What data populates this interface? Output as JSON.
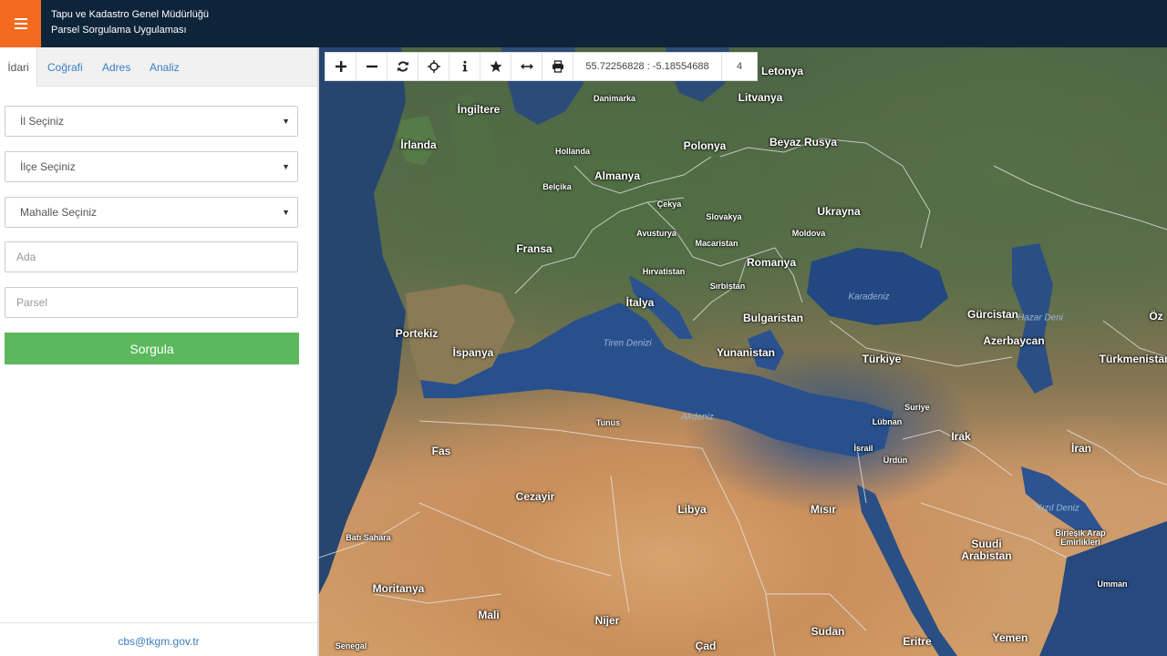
{
  "header": {
    "title_line1": "Tapu ve Kadastro Genel Müdürlüğü",
    "title_line2": "Parsel Sorgulama Uygulaması",
    "menu_icon": "hamburger-icon",
    "accent_color": "#f26b21",
    "bar_color": "#0e2439"
  },
  "sidebar": {
    "tabs": [
      {
        "label": "İdari",
        "active": true
      },
      {
        "label": "Coğrafi",
        "active": false
      },
      {
        "label": "Adres",
        "active": false
      },
      {
        "label": "Analiz",
        "active": false
      }
    ],
    "form": {
      "il_select": "İl Seçiniz",
      "ilce_select": "İlçe Seçiniz",
      "mahalle_select": "Mahalle Seçiniz",
      "ada_placeholder": "Ada",
      "parsel_placeholder": "Parsel",
      "submit_label": "Sorgula",
      "submit_color": "#5cb85c"
    },
    "footer_email": "cbs@tkgm.gov.tr"
  },
  "map": {
    "toolbar_icons": [
      "plus-icon",
      "minus-icon",
      "refresh-icon",
      "crosshair-icon",
      "info-icon",
      "star-icon",
      "measure-icon",
      "print-icon"
    ],
    "coordinates": "55.72256828 : -5.18554688",
    "zoom_level": "4",
    "labels": {
      "letonya": "Letonya",
      "litvanya": "Litvanya",
      "danimarka": "Danimarka",
      "ingiltere": "İngiltere",
      "irlanda": "İrlanda",
      "hollanda": "Hollanda",
      "belcika": "Belçika",
      "almanya": "Almanya",
      "polonya": "Polonya",
      "beyaz_rusya": "Beyaz Rusya",
      "cekya": "Çekya",
      "slovakya": "Slovakya",
      "ukrayna": "Ukrayna",
      "avusturya": "Avusturya",
      "macaristan": "Macaristan",
      "moldova": "Moldova",
      "fransa": "Fransa",
      "romanya": "Romanya",
      "hirvatistan": "Hırvatistan",
      "sirbistan": "Sırbistan",
      "italya": "İtalya",
      "bulgaristan": "Bulgaristan",
      "gurcistan": "Gürcistan",
      "portekiz": "Portekiz",
      "ispanya": "İspanya",
      "azerbaycan": "Azerbaycan",
      "yunanistan": "Yunanistan",
      "turkiye": "Türkiye",
      "turkmenistan": "Türkmenistan",
      "suriye": "Suriye",
      "lubnan": "Lübnan",
      "tunus": "Tunus",
      "irak": "Irak",
      "fas": "Fas",
      "israil": "İsrail",
      "urdun": "Ürdün",
      "iran": "İran",
      "cezayir": "Cezayir",
      "libya": "Libya",
      "misir": "Mısır",
      "bati_sahara": "Batı Sahara",
      "birlesik_arap": "Birleşik Arap Emirlikleri",
      "suudi": "Suudi Arabistan",
      "moritanya": "Moritanya",
      "umman": "Umman",
      "mali": "Mali",
      "nijer": "Nijer",
      "sudan": "Sudan",
      "yemen": "Yemen",
      "senegal": "Senegal",
      "cad": "Çad",
      "eritre": "Eritre",
      "oz": "Öz",
      "karadeniz": "Karadeniz",
      "hazar": "Hazar Deni",
      "tiren": "Tiren Denizi",
      "akdeniz": "Akdeniz",
      "kizil": "Kızıl Deniz"
    }
  }
}
